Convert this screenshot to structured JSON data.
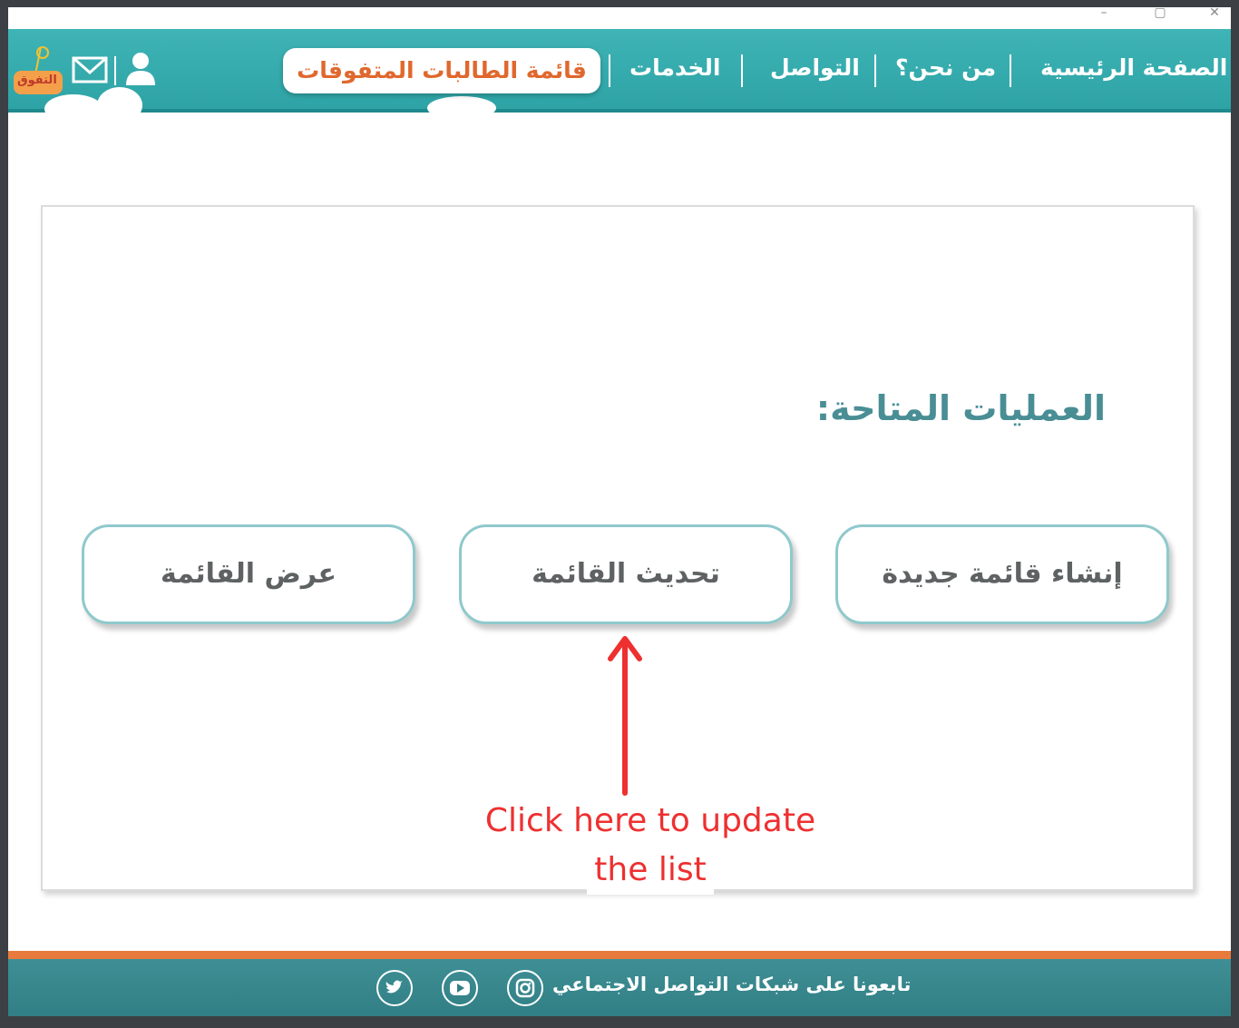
{
  "nav": {
    "items": [
      {
        "label": "الصفحة الرئيسية"
      },
      {
        "label": "من نحن؟"
      },
      {
        "label": "التواصل"
      },
      {
        "label": "الخدمات"
      }
    ],
    "active": "قائمة الطالبات المتفوقات",
    "logo_text": "التفوق"
  },
  "main": {
    "title": "العمليات المتاحة:",
    "buttons": [
      {
        "label": "إنشاء قائمة جديدة"
      },
      {
        "label": "تحديث القائمة"
      },
      {
        "label": "عرض القائمة"
      }
    ]
  },
  "annotation": {
    "line1": "Click here to update",
    "line2": "the list",
    "color": "#ee3030"
  },
  "footer": {
    "follow_text": "تابعونا على شبكات التواصل الاجتماعي",
    "social_icons": [
      "instagram-icon",
      "youtube-icon",
      "twitter-icon"
    ]
  },
  "colors": {
    "nav_teal": "#2ea3a6",
    "accent_orange": "#e0682e",
    "button_border": "#8fc9cc",
    "footer_teal": "#317f85"
  }
}
